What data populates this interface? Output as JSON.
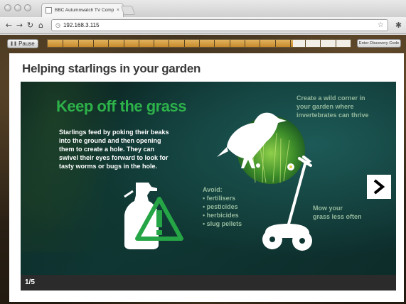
{
  "browser": {
    "tab_title": "BBC Autumnwatch TV Compa",
    "tab_close": "×",
    "url": "192.168.3.115",
    "icons": [
      "back-icon",
      "forward-icon",
      "reload-icon",
      "home-icon",
      "page-icon",
      "star-icon",
      "wrench-icon"
    ]
  },
  "player": {
    "pause_label": "Pause",
    "discovery_label": "Enter Discovery Code",
    "progress_fraction": 0.81,
    "segments": 20
  },
  "page": {
    "heading": "Helping starlings in your garden"
  },
  "slide": {
    "title": "Keep off the grass",
    "body": "Starlings feed by poking their beaks\ninto the ground and then opening\nthem to create a hole. They can\nswivel their eyes forward to look for\ntasty worms or bugs in the hole.",
    "corner_tip": "Create a wild corner in\nyour garden where\ninvertebrates can thrive",
    "avoid_title": "Avoid:",
    "avoid_items": [
      "fertilisers",
      "pesticides",
      "herbicides",
      "slug pellets"
    ],
    "mow_tip": "Mow your\ngrass less often",
    "counter": "1/5",
    "next_icon": "chevron-right-icon",
    "colors": {
      "title_green": "#2db24a",
      "muted_text": "#93b79b",
      "warning_green": "#25a545"
    }
  }
}
